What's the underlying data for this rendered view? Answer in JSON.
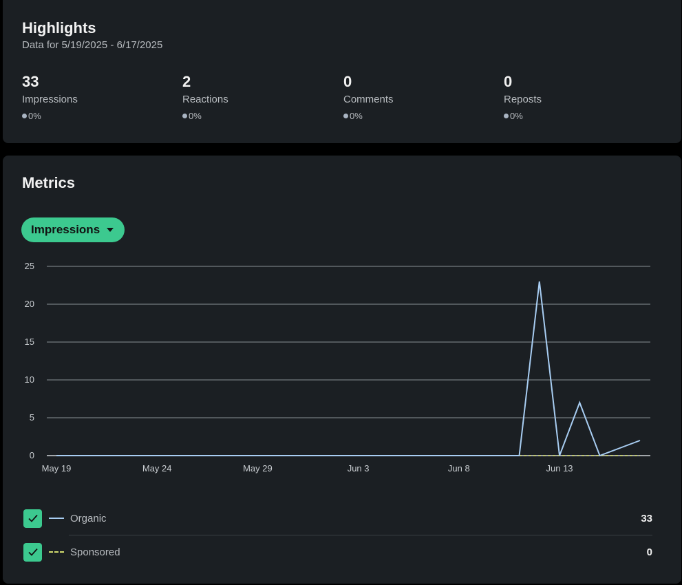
{
  "highlights": {
    "title": "Highlights",
    "subtitle": "Data for 5/19/2025 - 6/17/2025",
    "stats": [
      {
        "value": "33",
        "label": "Impressions",
        "change": "0%"
      },
      {
        "value": "2",
        "label": "Reactions",
        "change": "0%"
      },
      {
        "value": "0",
        "label": "Comments",
        "change": "0%"
      },
      {
        "value": "0",
        "label": "Reposts",
        "change": "0%"
      }
    ]
  },
  "metrics": {
    "title": "Metrics",
    "dropdown_label": "Impressions",
    "legend": [
      {
        "label": "Organic",
        "value": "33",
        "checked": true
      },
      {
        "label": "Sponsored",
        "value": "0",
        "checked": true
      }
    ]
  },
  "colors": {
    "accent": "#3cc98f",
    "organic": "#a8cdf2",
    "sponsored": "#d4de6f",
    "card": "#1b1f23"
  },
  "chart_data": {
    "type": "line",
    "x_labels": [
      "May 19",
      "May 24",
      "May 29",
      "Jun 3",
      "Jun 8",
      "Jun 13"
    ],
    "x": [
      "2025-05-19",
      "2025-05-20",
      "2025-05-21",
      "2025-05-22",
      "2025-05-23",
      "2025-05-24",
      "2025-05-25",
      "2025-05-26",
      "2025-05-27",
      "2025-05-28",
      "2025-05-29",
      "2025-05-30",
      "2025-05-31",
      "2025-06-01",
      "2025-06-02",
      "2025-06-03",
      "2025-06-04",
      "2025-06-05",
      "2025-06-06",
      "2025-06-07",
      "2025-06-08",
      "2025-06-09",
      "2025-06-10",
      "2025-06-11",
      "2025-06-12",
      "2025-06-13",
      "2025-06-14",
      "2025-06-15",
      "2025-06-16",
      "2025-06-17"
    ],
    "series": [
      {
        "name": "Organic",
        "values": [
          0,
          0,
          0,
          0,
          0,
          0,
          0,
          0,
          0,
          0,
          0,
          0,
          0,
          0,
          0,
          0,
          0,
          0,
          0,
          0,
          0,
          0,
          0,
          0,
          23,
          0,
          7,
          0,
          1,
          2
        ]
      },
      {
        "name": "Sponsored",
        "values": [
          0,
          0,
          0,
          0,
          0,
          0,
          0,
          0,
          0,
          0,
          0,
          0,
          0,
          0,
          0,
          0,
          0,
          0,
          0,
          0,
          0,
          0,
          0,
          0,
          0,
          0,
          0,
          0,
          0,
          0
        ]
      }
    ],
    "y_ticks": [
      0,
      5,
      10,
      15,
      20,
      25
    ],
    "ylim": [
      0,
      25
    ],
    "grid": true
  }
}
